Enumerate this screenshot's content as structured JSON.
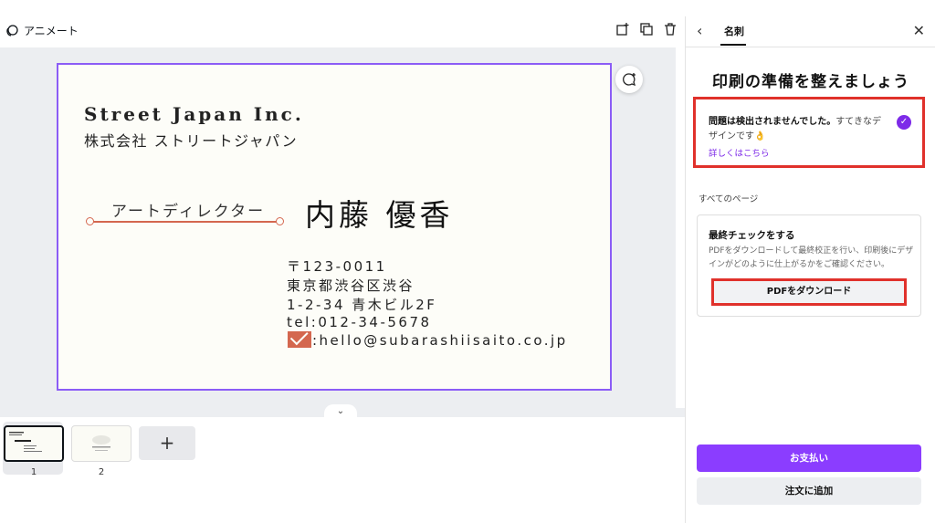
{
  "editor": {
    "animate_label": "アニメート",
    "card": {
      "company_en": "Street Japan Inc.",
      "company_ja": "株式会社 ストリートジャパン",
      "job_title": "アートディレクター",
      "name": "内藤 優香",
      "postal": "〒123-0011",
      "address1": "東京都渋谷区渋谷",
      "address2": "1-2-34 青木ビル2F",
      "tel": "tel:012-34-5678",
      "email": ":hello@subarashiisaito.co.jp"
    },
    "pages": [
      {
        "number": "1",
        "selected": true
      },
      {
        "number": "2",
        "selected": false
      }
    ],
    "add_page_label": "+",
    "accent_color": "#8b5cf6",
    "card_accent_color": "#d4674f"
  },
  "panel": {
    "tab_label": "名刺",
    "heading": "印刷の準備を整えましょう",
    "status_bold": "問題は検出されませんでした。",
    "status_text": "すてきなデザインです👌",
    "details_link": "詳しくはこちら",
    "all_pages_label": "すべてのページ",
    "final_check_title": "最終チェックをする",
    "final_check_desc": "PDFをダウンロードして最終校正を行い、印刷後にデザインがどのように仕上がるかをご確認ください。",
    "pdf_button": "PDFをダウンロード",
    "pay_button": "お支払い",
    "order_button": "注文に追加",
    "highlight_color": "#e0312b",
    "brand_color": "#8b3dff"
  }
}
